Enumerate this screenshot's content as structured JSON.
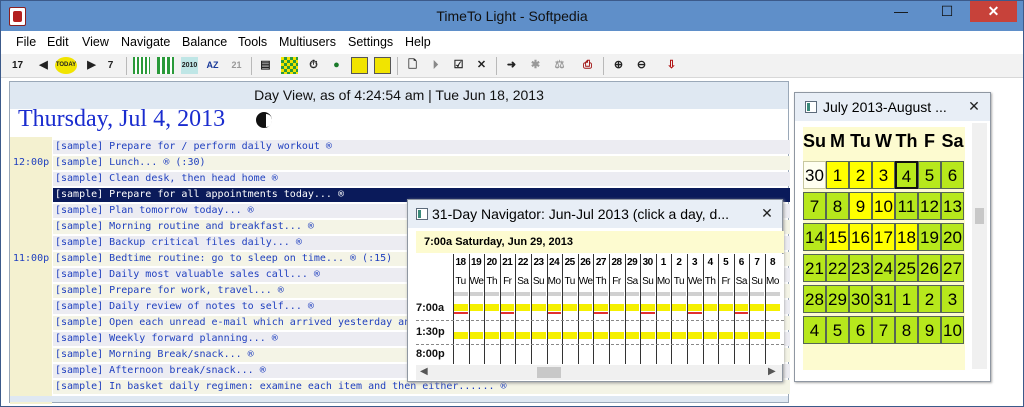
{
  "window": {
    "title": "TimeTo Light - Softpedia",
    "min": "—",
    "max": "☐",
    "close": "✕"
  },
  "menu": [
    "File",
    "Edit",
    "View",
    "Navigate",
    "Balance",
    "Tools",
    "Multiusers",
    "Settings",
    "Help"
  ],
  "toolbar": {
    "icons": [
      "calendar-prev-icon",
      "prev-arrow-icon",
      "today-icon",
      "next-arrow-icon",
      "calendar-next-icon",
      "grid-green-icon",
      "grid-green2-icon",
      "year-2010-icon",
      "sort-az-icon",
      "sort-num-icon",
      "print-preview-icon",
      "checker-icon",
      "stopwatch-icon",
      "globe-icon",
      "notes-icon",
      "notes2-icon",
      "new-doc-icon",
      "play-icon",
      "checkbox-icon",
      "cross-icon",
      "arrow-right-icon",
      "gear-icon",
      "scale-icon",
      "printer-icon",
      "zoom-in-icon",
      "zoom-out-icon",
      "flag-down-icon"
    ],
    "today_label": "TODAY",
    "labels": {
      "cal_prev": "17",
      "cal_next": "7",
      "year": "2010",
      "sort_az": "AZ",
      "sort_num": "21"
    }
  },
  "dayview": {
    "header": "Day View, as of 4:24:54 am | Tue Jun 18, 2013",
    "date": "Thursday, Jul 4, 2013",
    "rows": [
      {
        "time": "",
        "text": "[sample] Prepare for / perform daily workout  ®"
      },
      {
        "time": "12:00p",
        "text": "[sample] Lunch...  ®  (:30)"
      },
      {
        "time": "",
        "text": "[sample] Clean desk, then head home  ®"
      },
      {
        "time": "",
        "text": "[sample] Prepare for all appointments today...  ®",
        "selected": true
      },
      {
        "time": "",
        "text": "[sample] Plan tomorrow today...  ®"
      },
      {
        "time": "",
        "text": "[sample] Morning routine and breakfast...  ®"
      },
      {
        "time": "",
        "text": "[sample] Backup critical files daily...  ®"
      },
      {
        "time": "11:00p",
        "text": "[sample] Bedtime routine: go to sleep on time...  ®  (:15)"
      },
      {
        "time": "",
        "text": "[sample] Daily most valuable sales call...  ®"
      },
      {
        "time": "",
        "text": "[sample] Prepare for work, travel...  ®"
      },
      {
        "time": "",
        "text": "[sample] Daily review of notes to self...  ®"
      },
      {
        "time": "",
        "text": "[sample] Open each unread e-mail which arrived yesterday and today,"
      },
      {
        "time": "",
        "text": "[sample] Weekly forward planning...  ®"
      },
      {
        "time": "",
        "text": "[sample] Morning Break/snack...  ®"
      },
      {
        "time": "",
        "text": "[sample] Afternoon break/snack...  ®"
      },
      {
        "time": "",
        "text": "[sample] In basket daily regimen: examine each item and then either......  ®"
      }
    ]
  },
  "calendar": {
    "title": "July 2013-August ...",
    "weekdays": [
      "Su",
      "M",
      "Tu",
      "W",
      "Th",
      "F",
      "Sa"
    ],
    "weeks": [
      [
        "30",
        "1",
        "2",
        "3",
        "4",
        "5",
        "6"
      ],
      [
        "7",
        "8",
        "9",
        "10",
        "11",
        "12",
        "13"
      ],
      [
        "14",
        "15",
        "16",
        "17",
        "18",
        "19",
        "20"
      ],
      [
        "21",
        "22",
        "23",
        "24",
        "25",
        "26",
        "27"
      ],
      [
        "28",
        "29",
        "30",
        "31",
        "1",
        "2",
        "3"
      ],
      [
        "4",
        "5",
        "6",
        "7",
        "8",
        "9",
        "10"
      ]
    ],
    "today": "4",
    "colors": {
      "green": "#b7e81c",
      "yellow": "#ffff00",
      "out": "#fffff0",
      "panel": "#fdfbd0"
    }
  },
  "navigator": {
    "title": "31-Day Navigator: Jun-Jul 2013 (click a day, d...",
    "subtitle_time": "7:00a",
    "subtitle_date": "Saturday, Jun 29, 2013",
    "days": [
      "18",
      "19",
      "20",
      "21",
      "22",
      "23",
      "24",
      "25",
      "26",
      "27",
      "28",
      "29",
      "30",
      "1",
      "2",
      "3",
      "4",
      "5",
      "6",
      "7",
      "8"
    ],
    "weekdays": [
      "Tu",
      "We",
      "Th",
      "Fr",
      "Sa",
      "Su",
      "Mo",
      "Tu",
      "We",
      "Th",
      "Fr",
      "Sa",
      "Su",
      "Mo",
      "Tu",
      "We",
      "Th",
      "Fr",
      "Sa",
      "Su",
      "Mo"
    ],
    "times": [
      "7:00a",
      "1:30p",
      "8:00p"
    ]
  }
}
